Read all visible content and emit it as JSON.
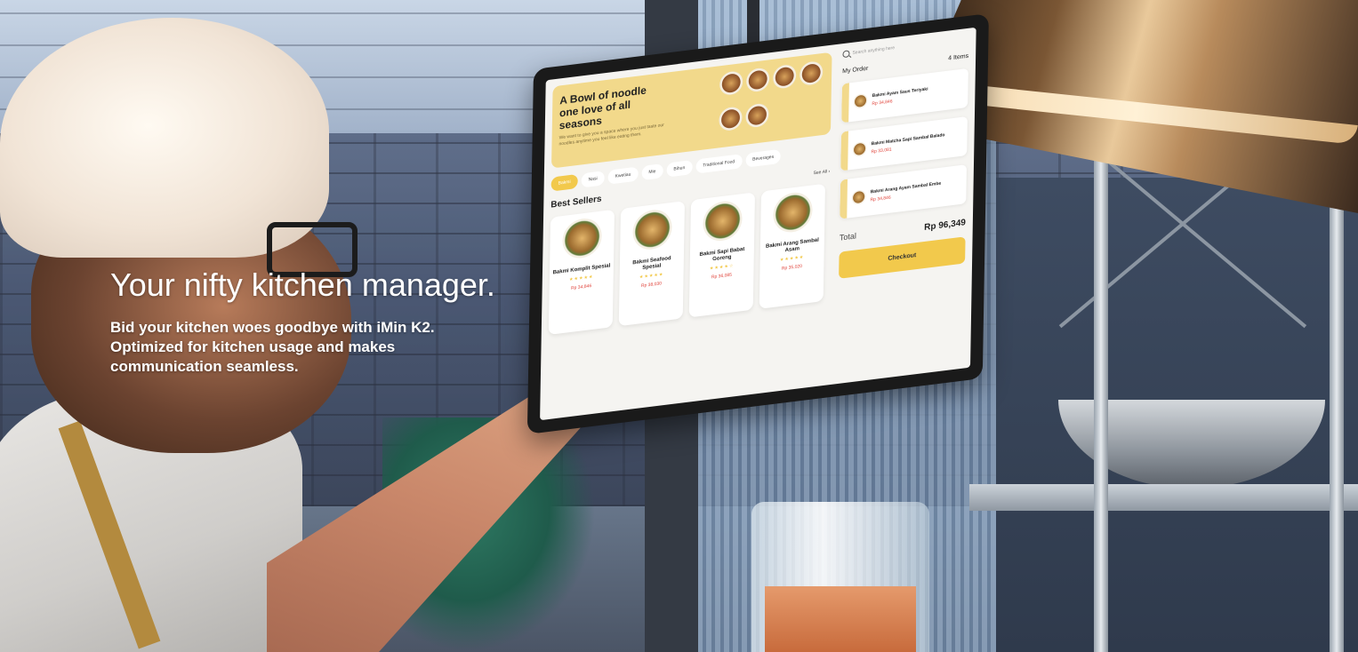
{
  "hero": {
    "title": "Your nifty kitchen manager.",
    "description_line1": "Bid your kitchen woes goodbye with iMin K2.",
    "description_line2": "Optimized for kitchen usage and makes",
    "description_line3": "communication seamless."
  },
  "tablet": {
    "banner": {
      "title_line1": "A Bowl of noodle",
      "title_line2": "one love of all seasons",
      "subtitle": "We want to give you a space where you just taste our noodles anytime you feel like eating them."
    },
    "categories": [
      "Bakmi",
      "Nasi",
      "Kwetiau",
      "Mie",
      "Bihun",
      "Traditional Food",
      "Beverages"
    ],
    "best_sellers_title": "Best Sellers",
    "see_all": "See All",
    "products": [
      {
        "name": "Bakmi Komplit Spesial",
        "stars": "★★★★★",
        "price": "Rp 34,846"
      },
      {
        "name": "Bakmi Seafood Spesial",
        "stars": "★★★★★",
        "price": "Rp 38,030"
      },
      {
        "name": "Bakmi Sapi Babat Goreng",
        "stars": "★★★★☆",
        "price": "Rp 36,085"
      },
      {
        "name": "Bakmi Arang Sambal Asam",
        "stars": "★★★★★",
        "price": "Rp 35,020"
      }
    ],
    "search_placeholder": "Search anything here",
    "order": {
      "title": "My Order",
      "count": "4 Items",
      "items": [
        {
          "name": "Bakmi Ayam Saus Teriyaki",
          "price": "Rp 34,846"
        },
        {
          "name": "Bakmi Matcha Sapi Sambal Balado",
          "price": "Rp 33,081"
        },
        {
          "name": "Bakmi Arang Ayam Sambal Embe",
          "price": "Rp 34,846"
        }
      ],
      "total_label": "Total",
      "total_value": "Rp 96,349",
      "checkout": "Checkout"
    }
  },
  "colors": {
    "accent": "#f2c94c",
    "banner": "#f2d98b",
    "price": "#e0433a"
  }
}
